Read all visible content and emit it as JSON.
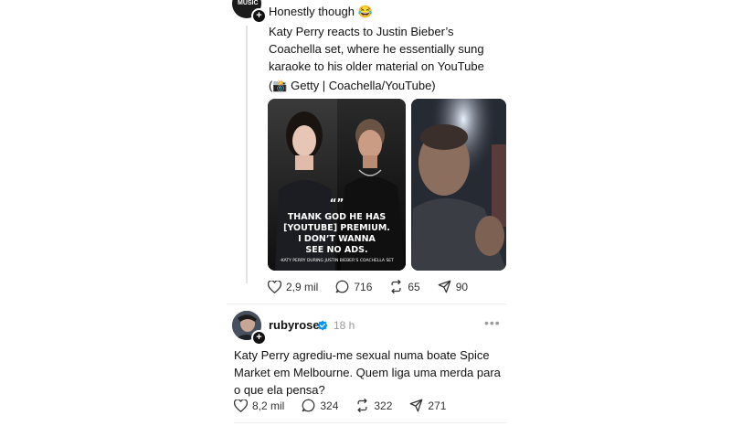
{
  "post1": {
    "header_text": "Honestly though 😂",
    "body": "Katy Perry reacts to Justin Bieber’s Coachella set, where he essentially sung karaoke to his older material on YouTube",
    "credit": "(📸 Getty | Coachella/YouTube)",
    "avatar_text": "MUSIC",
    "image_quote": {
      "mark": "“”",
      "lines": [
        "THANK GOD HE HAS",
        "[YOUTUBE] PREMIUM.",
        "I DON’T WANNA",
        "SEE NO ADS."
      ],
      "attribution": "-KATY PERRY DURING JUSTIN BIEBER’S COACHELLA SET"
    },
    "likes": "2,9 mil",
    "replies": "716",
    "reposts": "65",
    "shares": "90"
  },
  "post2": {
    "username": "rubyrose",
    "time": "18 h",
    "body": "Katy Perry agrediu-me sexual numa boate Spice Market em Melbourne. Quem liga uma merda para o que ela pensa?",
    "likes": "8,2 mil",
    "replies": "324",
    "reposts": "322",
    "shares": "271",
    "verified_color": "#0095f6"
  }
}
